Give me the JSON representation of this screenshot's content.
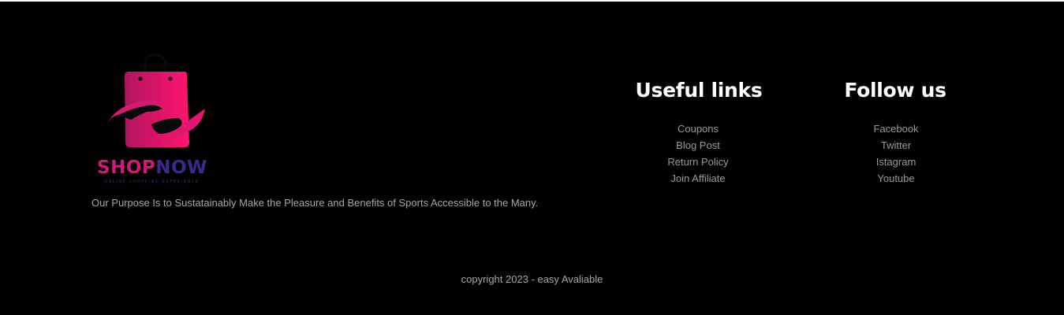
{
  "brand": {
    "name_part1": "SHOP",
    "name_part2": "NOW",
    "tagline": "ONLINE SHOPPING EXPERIENCE",
    "purpose": "Our Purpose Is to Sustatainably Make the Pleasure and Benefits of Sports Accessible to the Many.",
    "icon": "shopping-bag-hands-icon",
    "colors": {
      "bag_gradient_start": "#b0155f",
      "bag_gradient_end": "#ff1470",
      "shop_text": "#d4177a",
      "now_text": "#3b2a8c"
    }
  },
  "useful_links": {
    "heading": "Useful links",
    "items": [
      "Coupons",
      "Blog Post",
      "Return Policy",
      "Join Affiliate"
    ]
  },
  "follow_us": {
    "heading": "Follow us",
    "items": [
      "Facebook",
      "Twitter",
      "Istagram",
      "Youtube"
    ]
  },
  "copyright": "copyright 2023 - easy Avaliable",
  "colors": {
    "background": "#000000",
    "heading": "#ffffff",
    "link": "#9a9a9a",
    "body_text": "#a6a6a6"
  }
}
